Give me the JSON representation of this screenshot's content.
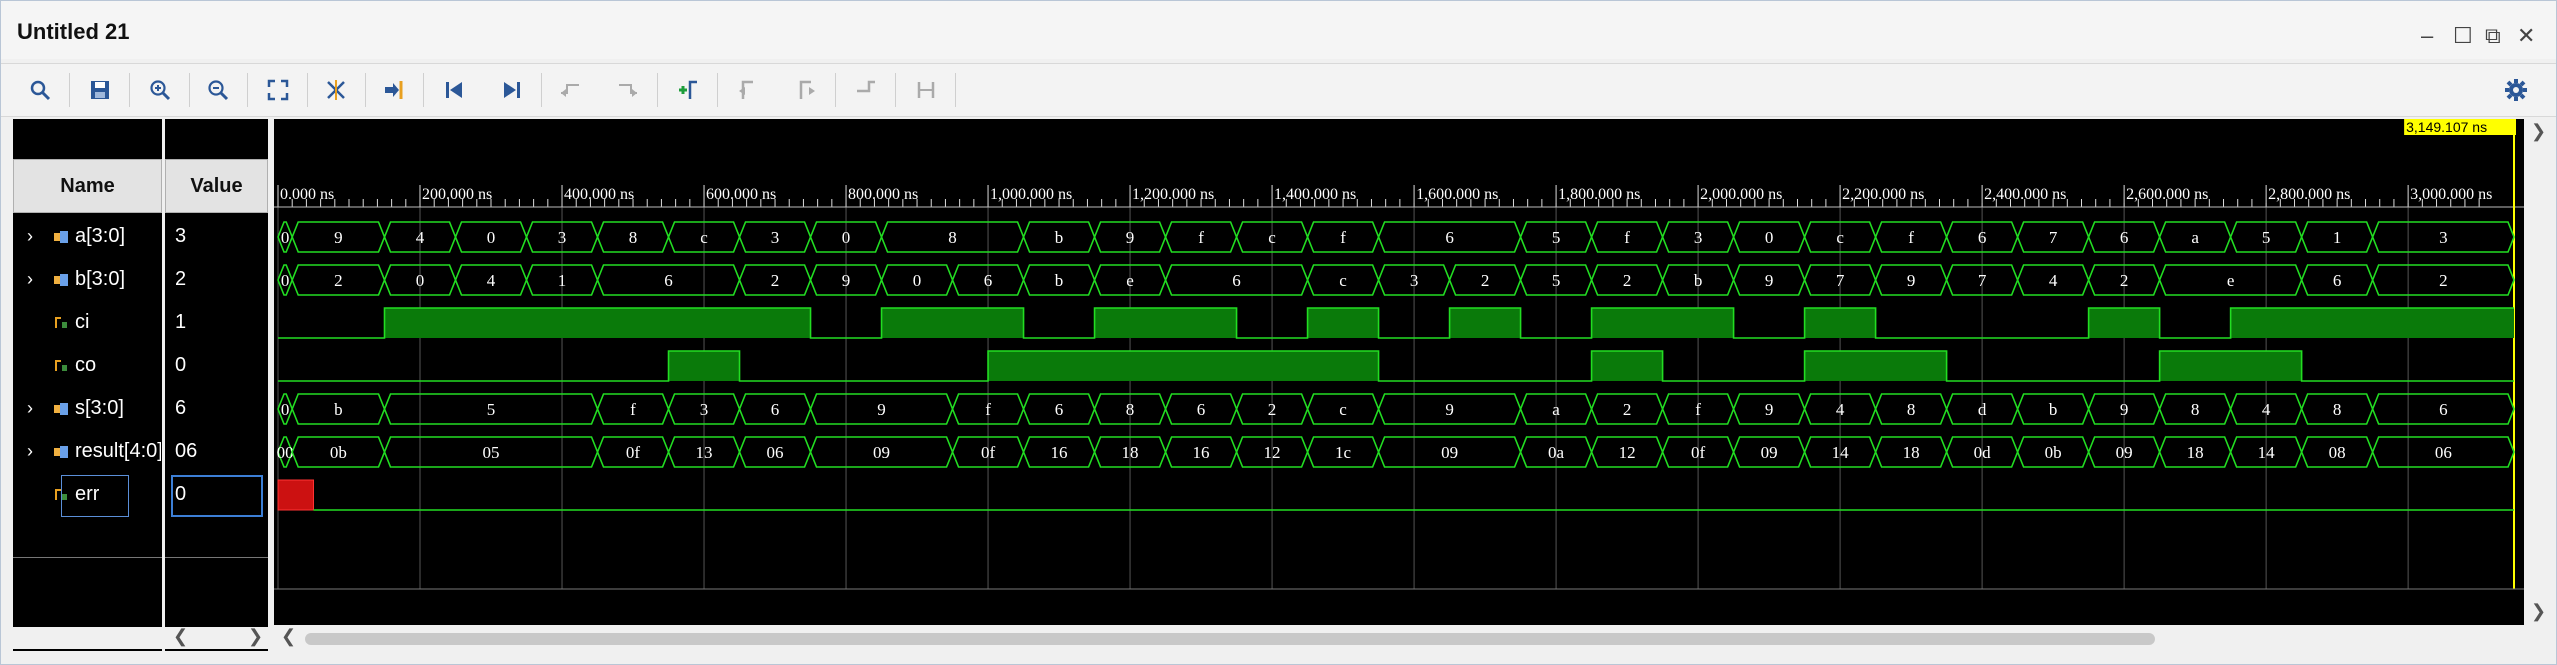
{
  "window": {
    "title": "Untitled 21"
  },
  "toolbar": {
    "icons": [
      "search-icon",
      "save-icon",
      "zoom-in-icon",
      "zoom-out-icon",
      "zoom-fit-icon",
      "cursor-snap-icon",
      "goto-cursor-icon",
      "goto-start-icon",
      "goto-end-icon",
      "prev-transition-icon",
      "next-transition-icon",
      "add-marker-icon",
      "prev-marker-icon",
      "next-marker-icon",
      "swap-cursors-icon",
      "fix-cursor-icon",
      "settings-icon"
    ]
  },
  "headers": {
    "name": "Name",
    "value": "Value"
  },
  "signals": [
    {
      "name": "a[3:0]",
      "value": "3",
      "type": "bus",
      "expandable": true
    },
    {
      "name": "b[3:0]",
      "value": "2",
      "type": "bus",
      "expandable": true
    },
    {
      "name": "ci",
      "value": "1",
      "type": "bit",
      "expandable": false
    },
    {
      "name": "co",
      "value": "0",
      "type": "bit",
      "expandable": false
    },
    {
      "name": "s[3:0]",
      "value": "6",
      "type": "bus",
      "expandable": true
    },
    {
      "name": "result[4:0]",
      "value": "06",
      "type": "bus",
      "expandable": true
    },
    {
      "name": "err",
      "value": "0",
      "type": "bit",
      "expandable": false
    }
  ],
  "timeline": {
    "cursor_label": "3,149.107 ns",
    "end_ns": 3149.107,
    "ticks": [
      "0.000 ns",
      "200.000 ns",
      "400.000 ns",
      "600.000 ns",
      "800.000 ns",
      "1,000.000 ns",
      "1,200.000 ns",
      "1,400.000 ns",
      "1,600.000 ns",
      "1,800.000 ns",
      "2,000.000 ns",
      "2,200.000 ns",
      "2,400.000 ns",
      "2,600.000 ns",
      "2,800.000 ns",
      "3,000.000 ns"
    ]
  },
  "waves": {
    "a": [
      [
        0,
        "0"
      ],
      [
        20,
        "9"
      ],
      [
        150,
        "4"
      ],
      [
        250,
        "0"
      ],
      [
        350,
        "3"
      ],
      [
        450,
        "8"
      ],
      [
        550,
        "c"
      ],
      [
        650,
        "3"
      ],
      [
        750,
        "0"
      ],
      [
        850,
        "8"
      ],
      [
        1050,
        "b"
      ],
      [
        1150,
        "9"
      ],
      [
        1250,
        "f"
      ],
      [
        1350,
        "c"
      ],
      [
        1450,
        "f"
      ],
      [
        1550,
        "6"
      ],
      [
        1750,
        "5"
      ],
      [
        1850,
        "f"
      ],
      [
        1950,
        "3"
      ],
      [
        2050,
        "0"
      ],
      [
        2150,
        "c"
      ],
      [
        2250,
        "f"
      ],
      [
        2350,
        "6"
      ],
      [
        2450,
        "7"
      ],
      [
        2550,
        "6"
      ],
      [
        2650,
        "a"
      ],
      [
        2750,
        "5"
      ],
      [
        2850,
        "1"
      ],
      [
        2950,
        "3"
      ]
    ],
    "b": [
      [
        0,
        "0"
      ],
      [
        20,
        "2"
      ],
      [
        150,
        "0"
      ],
      [
        250,
        "4"
      ],
      [
        350,
        "1"
      ],
      [
        450,
        "6"
      ],
      [
        650,
        "2"
      ],
      [
        750,
        "9"
      ],
      [
        850,
        "0"
      ],
      [
        950,
        "6"
      ],
      [
        1050,
        "b"
      ],
      [
        1150,
        "e"
      ],
      [
        1250,
        "6"
      ],
      [
        1450,
        "c"
      ],
      [
        1550,
        "3"
      ],
      [
        1650,
        "2"
      ],
      [
        1750,
        "5"
      ],
      [
        1850,
        "2"
      ],
      [
        1950,
        "b"
      ],
      [
        2050,
        "9"
      ],
      [
        2150,
        "7"
      ],
      [
        2250,
        "9"
      ],
      [
        2350,
        "7"
      ],
      [
        2450,
        "4"
      ],
      [
        2550,
        "2"
      ],
      [
        2650,
        "e"
      ],
      [
        2850,
        "6"
      ],
      [
        2950,
        "2"
      ]
    ],
    "ci": [
      [
        0,
        0
      ],
      [
        150,
        1
      ],
      [
        750,
        0
      ],
      [
        850,
        1
      ],
      [
        1050,
        0
      ],
      [
        1150,
        1
      ],
      [
        1350,
        0
      ],
      [
        1450,
        1
      ],
      [
        1550,
        0
      ],
      [
        1650,
        1
      ],
      [
        1750,
        0
      ],
      [
        1850,
        1
      ],
      [
        2050,
        0
      ],
      [
        2150,
        1
      ],
      [
        2250,
        0
      ],
      [
        2550,
        1
      ],
      [
        2650,
        0
      ],
      [
        2750,
        1
      ]
    ],
    "co": [
      [
        0,
        0
      ],
      [
        550,
        1
      ],
      [
        650,
        0
      ],
      [
        1000,
        1
      ],
      [
        1550,
        0
      ],
      [
        1850,
        1
      ],
      [
        1950,
        0
      ],
      [
        2150,
        1
      ],
      [
        2350,
        0
      ],
      [
        2650,
        1
      ],
      [
        2850,
        0
      ]
    ],
    "s": [
      [
        0,
        "0"
      ],
      [
        20,
        "b"
      ],
      [
        150,
        "5"
      ],
      [
        450,
        "f"
      ],
      [
        550,
        "3"
      ],
      [
        650,
        "6"
      ],
      [
        750,
        "9"
      ],
      [
        950,
        "f"
      ],
      [
        1050,
        "6"
      ],
      [
        1150,
        "8"
      ],
      [
        1250,
        "6"
      ],
      [
        1350,
        "2"
      ],
      [
        1450,
        "c"
      ],
      [
        1550,
        "9"
      ],
      [
        1750,
        "a"
      ],
      [
        1850,
        "2"
      ],
      [
        1950,
        "f"
      ],
      [
        2050,
        "9"
      ],
      [
        2150,
        "4"
      ],
      [
        2250,
        "8"
      ],
      [
        2350,
        "d"
      ],
      [
        2450,
        "b"
      ],
      [
        2550,
        "9"
      ],
      [
        2650,
        "8"
      ],
      [
        2750,
        "4"
      ],
      [
        2850,
        "8"
      ],
      [
        2950,
        "6"
      ]
    ],
    "result": [
      [
        0,
        "00"
      ],
      [
        20,
        "0b"
      ],
      [
        150,
        "05"
      ],
      [
        450,
        "0f"
      ],
      [
        550,
        "13"
      ],
      [
        650,
        "06"
      ],
      [
        750,
        "09"
      ],
      [
        950,
        "0f"
      ],
      [
        1050,
        "16"
      ],
      [
        1150,
        "18"
      ],
      [
        1250,
        "16"
      ],
      [
        1350,
        "12"
      ],
      [
        1450,
        "1c"
      ],
      [
        1550,
        "09"
      ],
      [
        1750,
        "0a"
      ],
      [
        1850,
        "12"
      ],
      [
        1950,
        "0f"
      ],
      [
        2050,
        "09"
      ],
      [
        2150,
        "14"
      ],
      [
        2250,
        "18"
      ],
      [
        2350,
        "0d"
      ],
      [
        2450,
        "0b"
      ],
      [
        2550,
        "09"
      ],
      [
        2650,
        "18"
      ],
      [
        2750,
        "14"
      ],
      [
        2850,
        "08"
      ],
      [
        2950,
        "06"
      ]
    ],
    "err": [
      [
        0,
        "x"
      ],
      [
        50,
        0
      ]
    ]
  },
  "colors": {
    "wave": "#22dd22",
    "fill": "#0a7a0a",
    "cursor": "#ffff00",
    "undef": "#cc1111"
  }
}
